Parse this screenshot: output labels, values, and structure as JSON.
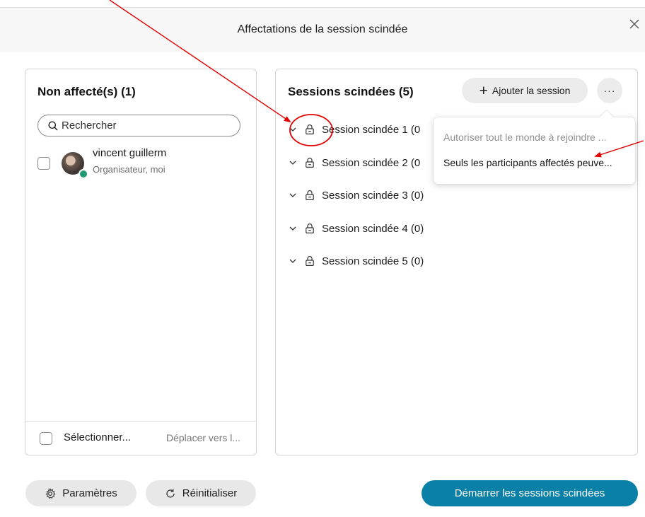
{
  "dialog": {
    "title": "Affectations de la session scindée"
  },
  "unassigned": {
    "title": "Non affecté(s) (1)",
    "search_placeholder": "Rechercher",
    "participants": [
      {
        "name": "vincent guillerm",
        "role": "Organisateur, moi"
      }
    ],
    "footer": {
      "select_all": "Sélectionner...",
      "move_to": "Déplacer vers l..."
    }
  },
  "sessions": {
    "title": "Sessions scindées (5)",
    "add_label": "Ajouter la session",
    "more_label": "···",
    "items": [
      {
        "label": "Session scindée 1 (0"
      },
      {
        "label": "Session scindée 2 (0"
      },
      {
        "label": "Session scindée 3 (0)"
      },
      {
        "label": "Session scindée 4 (0)"
      },
      {
        "label": "Session scindée 5 (0)"
      }
    ]
  },
  "menu": {
    "items": [
      {
        "label": "Autoriser tout le monde à rejoindre ...",
        "state": "disabled"
      },
      {
        "label": "Seuls les participants affectés peuve...",
        "state": "enabled"
      }
    ]
  },
  "footer": {
    "settings_label": "Paramètres",
    "reset_label": "Réinitialiser",
    "start_label": "Démarrer les sessions scindées"
  },
  "colors": {
    "accent": "#0a7fa8",
    "annotation": "#e00000"
  },
  "icons": [
    "close-icon",
    "search-icon",
    "plus-icon",
    "more-icon",
    "chevron-down-icon",
    "lock-icon",
    "gear-icon",
    "refresh-icon"
  ]
}
